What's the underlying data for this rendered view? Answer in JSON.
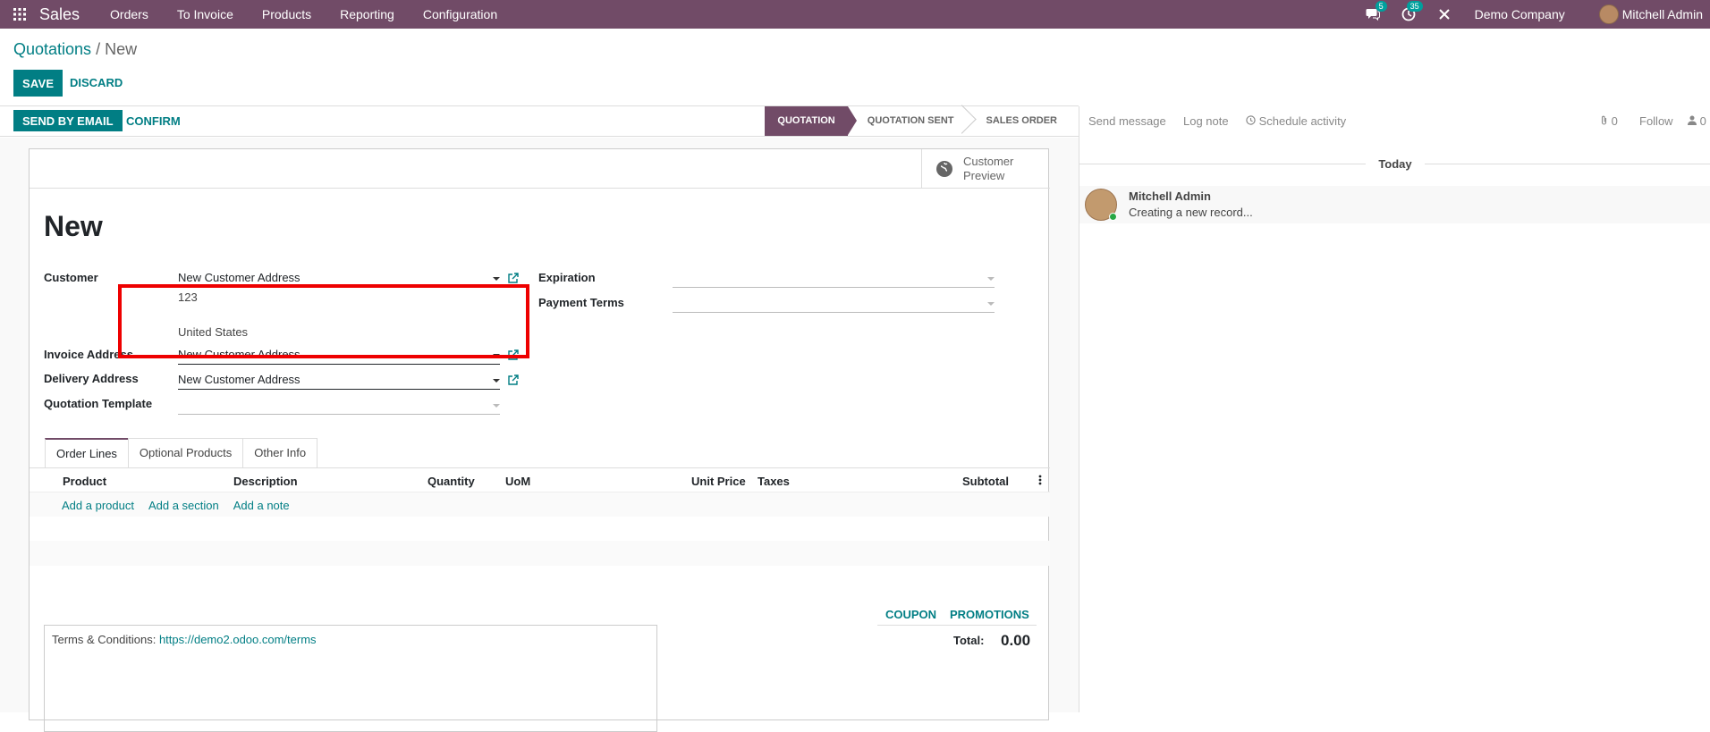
{
  "nav": {
    "app": "Sales",
    "menus": [
      "Orders",
      "To Invoice",
      "Products",
      "Reporting",
      "Configuration"
    ],
    "messages_badge": "5",
    "activities_badge": "35",
    "company": "Demo Company",
    "user": "Mitchell Admin"
  },
  "breadcrumb": {
    "parent": "Quotations",
    "sep": "/",
    "current": "New"
  },
  "buttons": {
    "save": "SAVE",
    "discard": "DISCARD",
    "send_email": "SEND BY EMAIL",
    "confirm": "CONFIRM"
  },
  "stages": [
    "QUOTATION",
    "QUOTATION SENT",
    "SALES ORDER"
  ],
  "active_stage": "QUOTATION",
  "smart_button": {
    "line1": "Customer",
    "line2": "Preview"
  },
  "form": {
    "title": "New",
    "customer_label": "Customer",
    "customer_value": "New Customer Address",
    "address_line1": "123",
    "address_line2": "United States",
    "invoice_label": "Invoice Address",
    "invoice_value": "New Customer Address",
    "delivery_label": "Delivery Address",
    "delivery_value": "New Customer Address",
    "template_label": "Quotation Template",
    "template_value": "",
    "expiration_label": "Expiration",
    "expiration_value": "",
    "payment_terms_label": "Payment Terms",
    "payment_terms_value": ""
  },
  "tabs": [
    "Order Lines",
    "Optional Products",
    "Other Info"
  ],
  "columns": [
    "Product",
    "Description",
    "Quantity",
    "UoM",
    "Unit Price",
    "Taxes",
    "Subtotal"
  ],
  "add_links": [
    "Add a product",
    "Add a section",
    "Add a note"
  ],
  "footer": {
    "coupon": "COUPON",
    "promotions": "PROMOTIONS",
    "total_label": "Total:",
    "total_value": "0.00",
    "terms_label": "Terms & Conditions:",
    "terms_link": "https://demo2.odoo.com/terms"
  },
  "chatter": {
    "send_message": "Send message",
    "log_note": "Log note",
    "schedule_activity": "Schedule activity",
    "attachments": "0",
    "follow": "Follow",
    "followers": "0",
    "today": "Today",
    "author": "Mitchell Admin",
    "message": "Creating a new record..."
  },
  "colors": {
    "brand": "#714b67",
    "accent": "#017e84",
    "highlight": "#ee0000"
  }
}
